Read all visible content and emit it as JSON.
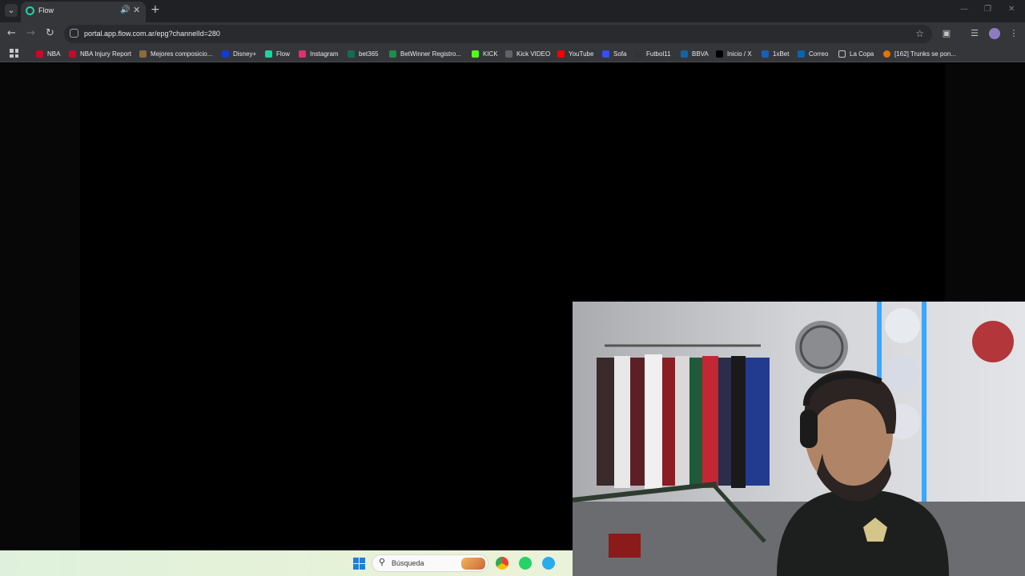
{
  "browser": {
    "tab": {
      "title": "Flow"
    },
    "address": {
      "url": "portal.app.flow.com.ar/epg?channelId=280"
    },
    "bookmarks": [
      {
        "label": "NBA",
        "color": "#c9082a"
      },
      {
        "label": "NBA Injury Report",
        "color": "#c9082a"
      },
      {
        "label": "Mejores composicio...",
        "color": "#8a6d3b"
      },
      {
        "label": "Disney+",
        "color": "#113ccf"
      },
      {
        "label": "Flow",
        "color": "#1dd3a2"
      },
      {
        "label": "Instagram",
        "color": "#e1306c"
      },
      {
        "label": "bet365",
        "color": "#126e51"
      },
      {
        "label": "BetWinner Registro...",
        "color": "#1a8f4c"
      },
      {
        "label": "KICK",
        "color": "#53fc18"
      },
      {
        "label": "Kick VIDEO",
        "color": "#5f6368"
      },
      {
        "label": "YouTube",
        "color": "#ff0000"
      },
      {
        "label": "Sofa",
        "color": "#374df5"
      },
      {
        "label": "Futbol11",
        "color": "#333333"
      },
      {
        "label": "BBVA",
        "color": "#1464a5"
      },
      {
        "label": "Inicio / X",
        "color": "#000000"
      },
      {
        "label": "1xBet",
        "color": "#1a5fb4"
      },
      {
        "label": "Correo",
        "color": "#0a64ad"
      },
      {
        "label": "La Copa",
        "color": "#c4c7c5"
      },
      {
        "label": "[162] Trunks se pon...",
        "color": "#e37400"
      }
    ]
  },
  "taskbar": {
    "search": {
      "placeholder": "Búsqueda"
    }
  }
}
